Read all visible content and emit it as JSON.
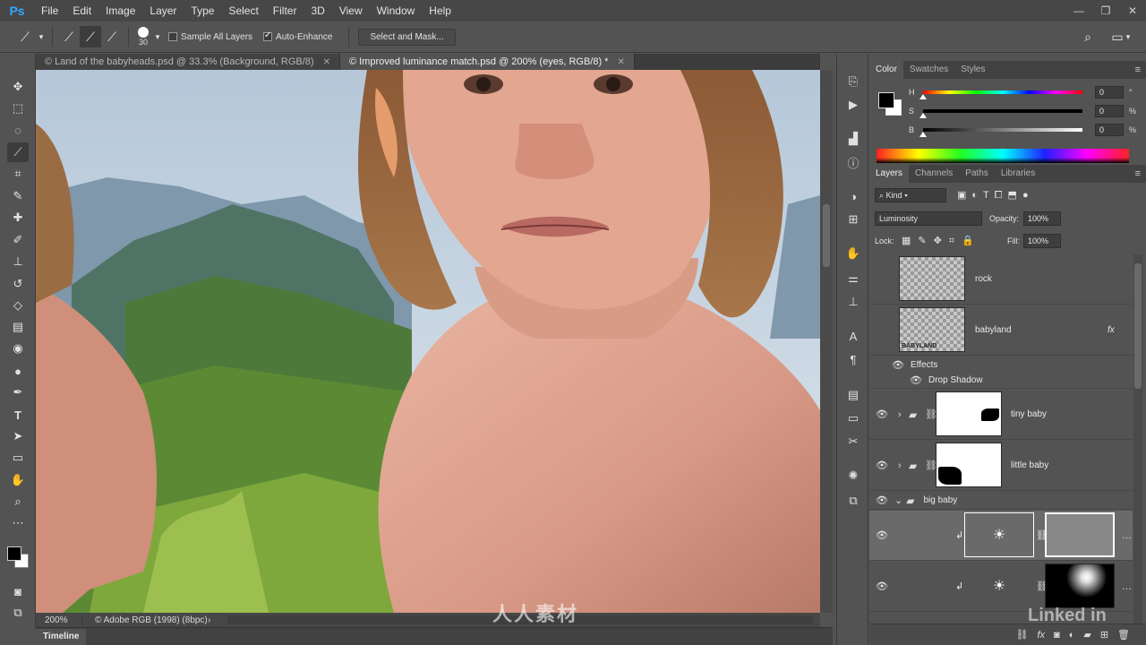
{
  "app": {
    "logo": "Ps"
  },
  "menu": [
    "File",
    "Edit",
    "Image",
    "Layer",
    "Type",
    "Select",
    "Filter",
    "3D",
    "View",
    "Window",
    "Help"
  ],
  "window_controls": {
    "minimize": "—",
    "restore": "❐",
    "close": "✕"
  },
  "options": {
    "brush_size": "30",
    "sample_all_layers": "Sample All Layers",
    "sample_all_checked": false,
    "auto_enhance": "Auto-Enhance",
    "auto_enhance_checked": true,
    "select_mask": "Select and Mask..."
  },
  "tabs": [
    {
      "label": "© Land of the babyheads.psd @ 33.3% (Background, RGB/8)",
      "close": "✕",
      "active": false
    },
    {
      "label": "© Improved luminance match.psd @ 200% (eyes, RGB/8) *",
      "close": "✕",
      "active": true
    }
  ],
  "status": {
    "zoom": "200%",
    "profile": "© Adobe RGB (1998) (8bpc)",
    "arrow": "›"
  },
  "timeline": {
    "label": "Timeline"
  },
  "color_panel": {
    "tabs": [
      "Color",
      "Swatches",
      "Styles"
    ],
    "h": {
      "label": "H",
      "value": "0",
      "unit": "°"
    },
    "s": {
      "label": "S",
      "value": "0",
      "unit": "%"
    },
    "b": {
      "label": "B",
      "value": "0",
      "unit": "%"
    },
    "foreground": "#000000",
    "background": "#ffffff"
  },
  "layers_panel": {
    "tabs": [
      "Layers",
      "Channels",
      "Paths",
      "Libraries"
    ],
    "kind": "Kind",
    "blend_mode": "Luminosity",
    "opacity_label": "Opacity:",
    "opacity": "100%",
    "lock_label": "Lock:",
    "fill_label": "Fill:",
    "fill": "100%",
    "layers": [
      {
        "name": "rock",
        "visible": false
      },
      {
        "name": "babyland",
        "visible": false,
        "fx": "fx"
      },
      {
        "name": "Effects"
      },
      {
        "name": "Drop Shadow"
      },
      {
        "name": "tiny baby",
        "visible": true
      },
      {
        "name": "little baby",
        "visible": true
      },
      {
        "name": "big baby",
        "visible": true
      }
    ],
    "thumb_text": "BABYLAND"
  },
  "watermarks": {
    "linkedin": "Linked in",
    "cn": "人人素材"
  }
}
